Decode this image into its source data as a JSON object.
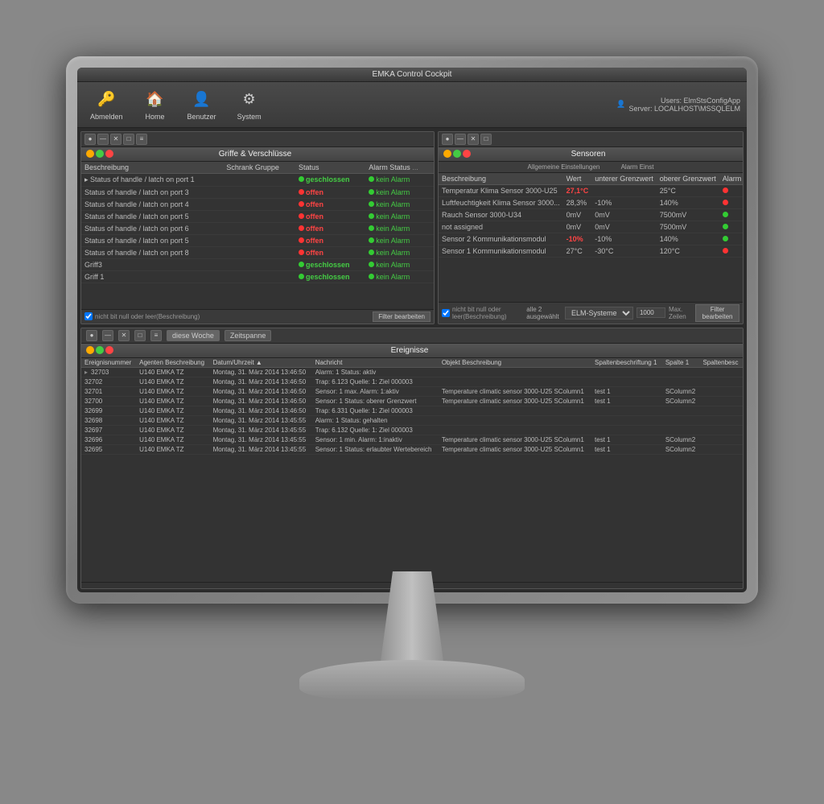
{
  "app": {
    "title": "EMKA Control Cockpit",
    "titlebar_controls": [
      "minimize",
      "maximize",
      "close"
    ]
  },
  "toolbar": {
    "buttons": [
      {
        "id": "abmelden",
        "label": "Abmelden",
        "icon": "🔑"
      },
      {
        "id": "home",
        "label": "Home",
        "icon": "🏠"
      },
      {
        "id": "benutzer",
        "label": "Benutzer",
        "icon": "👤"
      },
      {
        "id": "system",
        "label": "System",
        "icon": "⚙"
      }
    ]
  },
  "user_info": {
    "label": "Users: ElmStsConfigApp",
    "server": "Server: LOCALHOST\\MSSQLELM"
  },
  "griffe_panel": {
    "title": "Griffe & Verschlüsse",
    "columns": [
      "Beschreibung",
      "Schrank Gruppe",
      "Status",
      "Alarm Status"
    ],
    "rows": [
      {
        "desc": "▸ Status of handle / latch on port 1",
        "gruppe": "",
        "status": "geschlossen",
        "status_type": "closed",
        "alarm": "kein Alarm",
        "alarm_type": "ok"
      },
      {
        "desc": "Status of handle / latch on port 3",
        "gruppe": "",
        "status": "offen",
        "status_type": "open",
        "alarm": "kein Alarm",
        "alarm_type": "ok"
      },
      {
        "desc": "Status of handle / latch on port 4",
        "gruppe": "",
        "status": "offen",
        "status_type": "open",
        "alarm": "kein Alarm",
        "alarm_type": "ok"
      },
      {
        "desc": "Status of handle / latch on port 5",
        "gruppe": "",
        "status": "offen",
        "status_type": "open",
        "alarm": "kein Alarm",
        "alarm_type": "ok"
      },
      {
        "desc": "Status of handle / latch on port 6",
        "gruppe": "",
        "status": "offen",
        "status_type": "open",
        "alarm": "kein Alarm",
        "alarm_type": "ok"
      },
      {
        "desc": "Status of handle / latch on port 5",
        "gruppe": "",
        "status": "offen",
        "status_type": "open",
        "alarm": "kein Alarm",
        "alarm_type": "ok"
      },
      {
        "desc": "Status of handle / latch on port 8",
        "gruppe": "",
        "status": "offen",
        "status_type": "open",
        "alarm": "kein Alarm",
        "alarm_type": "ok"
      },
      {
        "desc": "Griff3",
        "gruppe": "",
        "status": "geschlossen",
        "status_type": "closed",
        "alarm": "kein Alarm",
        "alarm_type": "ok"
      },
      {
        "desc": "Griff 1",
        "gruppe": "",
        "status": "geschlossen",
        "status_type": "closed",
        "alarm": "kein Alarm",
        "alarm_type": "ok"
      }
    ],
    "footer_checkbox": "nicht bit null oder leer(Beschreibung)",
    "footer_btn": "Filter bearbeiten"
  },
  "sensoren_panel": {
    "title": "Sensoren",
    "subheader_general": "Allgemeine Einstellungen",
    "subheader_alarm": "Alarm Einst",
    "columns": [
      "Beschreibung",
      "Wert",
      "unterer Grenzwert",
      "oberer Grenzwert",
      "Alarm"
    ],
    "rows": [
      {
        "desc": "Temperatur Klima Sensor 3000-U25",
        "wert": "27,1°C",
        "wert_type": "red",
        "unterer": "",
        "oberer": "25°C",
        "alarm": "",
        "alarm_dot": "red"
      },
      {
        "desc": "Luftfeuchtigkeit Klima Sensor 3000...",
        "wert": "28,3%",
        "wert_type": "normal",
        "unterer": "-10%",
        "oberer": "140%",
        "alarm": "",
        "alarm_dot": "red"
      },
      {
        "desc": "Rauch Sensor 3000-U34",
        "wert": "0mV",
        "wert_type": "normal",
        "unterer": "0mV",
        "oberer": "7500mV",
        "alarm": "",
        "alarm_dot": "green"
      },
      {
        "desc": "not assigned",
        "wert": "0mV",
        "wert_type": "normal",
        "unterer": "0mV",
        "oberer": "7500mV",
        "alarm": "",
        "alarm_dot": "green"
      },
      {
        "desc": "Sensor 2 Kommunikationsmodul",
        "wert": "-10%",
        "wert_type": "red",
        "unterer": "-10%",
        "oberer": "140%",
        "alarm": "",
        "alarm_dot": "green"
      },
      {
        "desc": "Sensor 1 Kommunikationsmodul",
        "wert": "27°C",
        "wert_type": "normal",
        "unterer": "-30°C",
        "oberer": "120°C",
        "alarm": "",
        "alarm_dot": "red"
      }
    ],
    "footer_checkbox": "nicht bit null oder leer(Beschreibung)",
    "footer_info": "alle 2 ausgewählt",
    "footer_select": "ELM-Systeme",
    "footer_val": "1000",
    "footer_max": "Max. Zeilen",
    "footer_btn": "Filter bearbeiten"
  },
  "ereignisse_panel": {
    "title": "Ereignisse",
    "tabs": [
      "diese Woche",
      "Zeitspanne"
    ],
    "columns": [
      "Ereignisnummer",
      "Agenten Beschreibung",
      "Datum/Uhrzeit",
      "▲ Nachricht",
      "Objekt Beschreibung",
      "Spaltenbeschriftung 1",
      "Spalte 1",
      "Spaltenbesc"
    ],
    "rows": [
      {
        "id": "32703",
        "agent": "U140 EMKA TZ",
        "datetime": "Montag, 31. März 2014 13:46:50",
        "nachricht": "Alarm: 1 Status: aktiv",
        "objekt": "",
        "sp1": "",
        "s1": "",
        "sbc": "",
        "selected": false
      },
      {
        "id": "32702",
        "agent": "U140 EMKA TZ",
        "datetime": "Montag, 31. März 2014 13:46:50",
        "nachricht": "Trap: 6.123 Quelle: 1: Ziel 000003",
        "objekt": "",
        "sp1": "",
        "s1": "",
        "sbc": "",
        "selected": false
      },
      {
        "id": "32701",
        "agent": "U140 EMKA TZ",
        "datetime": "Montag, 31. März 2014 13:46:50",
        "nachricht": "Sensor: 1 max. Alarm: 1:aktiv",
        "objekt": "Temperature climatic sensor 3000-U25 SColumn1",
        "sp1": "test 1",
        "s1": "SColumn2",
        "sbc": "",
        "selected": false
      },
      {
        "id": "32700",
        "agent": "U140 EMKA TZ",
        "datetime": "Montag, 31. März 2014 13:46:50",
        "nachricht": "Sensor: 1 Status: oberer Grenzwert",
        "objekt": "Temperature climatic sensor 3000-U25 SColumn1",
        "sp1": "test 1",
        "s1": "SColumn2",
        "sbc": "",
        "selected": false
      },
      {
        "id": "32699",
        "agent": "U140 EMKA TZ",
        "datetime": "Montag, 31. März 2014 13:46:50",
        "nachricht": "Trap: 6.331 Quelle: 1: Ziel 000003",
        "objekt": "",
        "sp1": "",
        "s1": "",
        "sbc": "",
        "selected": false
      },
      {
        "id": "32698",
        "agent": "U140 EMKA TZ",
        "datetime": "Montag, 31. März 2014 13:45:55",
        "nachricht": "Alarm: 1 Status: gehalten",
        "objekt": "",
        "sp1": "",
        "s1": "",
        "sbc": "",
        "selected": false
      },
      {
        "id": "32697",
        "agent": "U140 EMKA TZ",
        "datetime": "Montag, 31. März 2014 13:45:55",
        "nachricht": "Trap: 6.132 Quelle: 1: Ziel 000003",
        "objekt": "",
        "sp1": "",
        "s1": "",
        "sbc": "",
        "selected": false
      },
      {
        "id": "32696",
        "agent": "U140 EMKA TZ",
        "datetime": "Montag, 31. März 2014 13:45:55",
        "nachricht": "Sensor: 1 min. Alarm: 1:inaktiv",
        "objekt": "Temperature climatic sensor 3000-U25 SColumn1",
        "sp1": "test 1",
        "s1": "SColumn2",
        "sbc": "",
        "selected": false
      },
      {
        "id": "32695",
        "agent": "U140 EMKA TZ",
        "datetime": "Montag, 31. März 2014 13:45:55",
        "nachricht": "Sensor: 1 Status: erlaubter Wertebereich",
        "objekt": "Temperature climatic sensor 3000-U25 SColumn1",
        "sp1": "test 1",
        "s1": "SColumn2",
        "sbc": "",
        "selected": false
      }
    ]
  }
}
